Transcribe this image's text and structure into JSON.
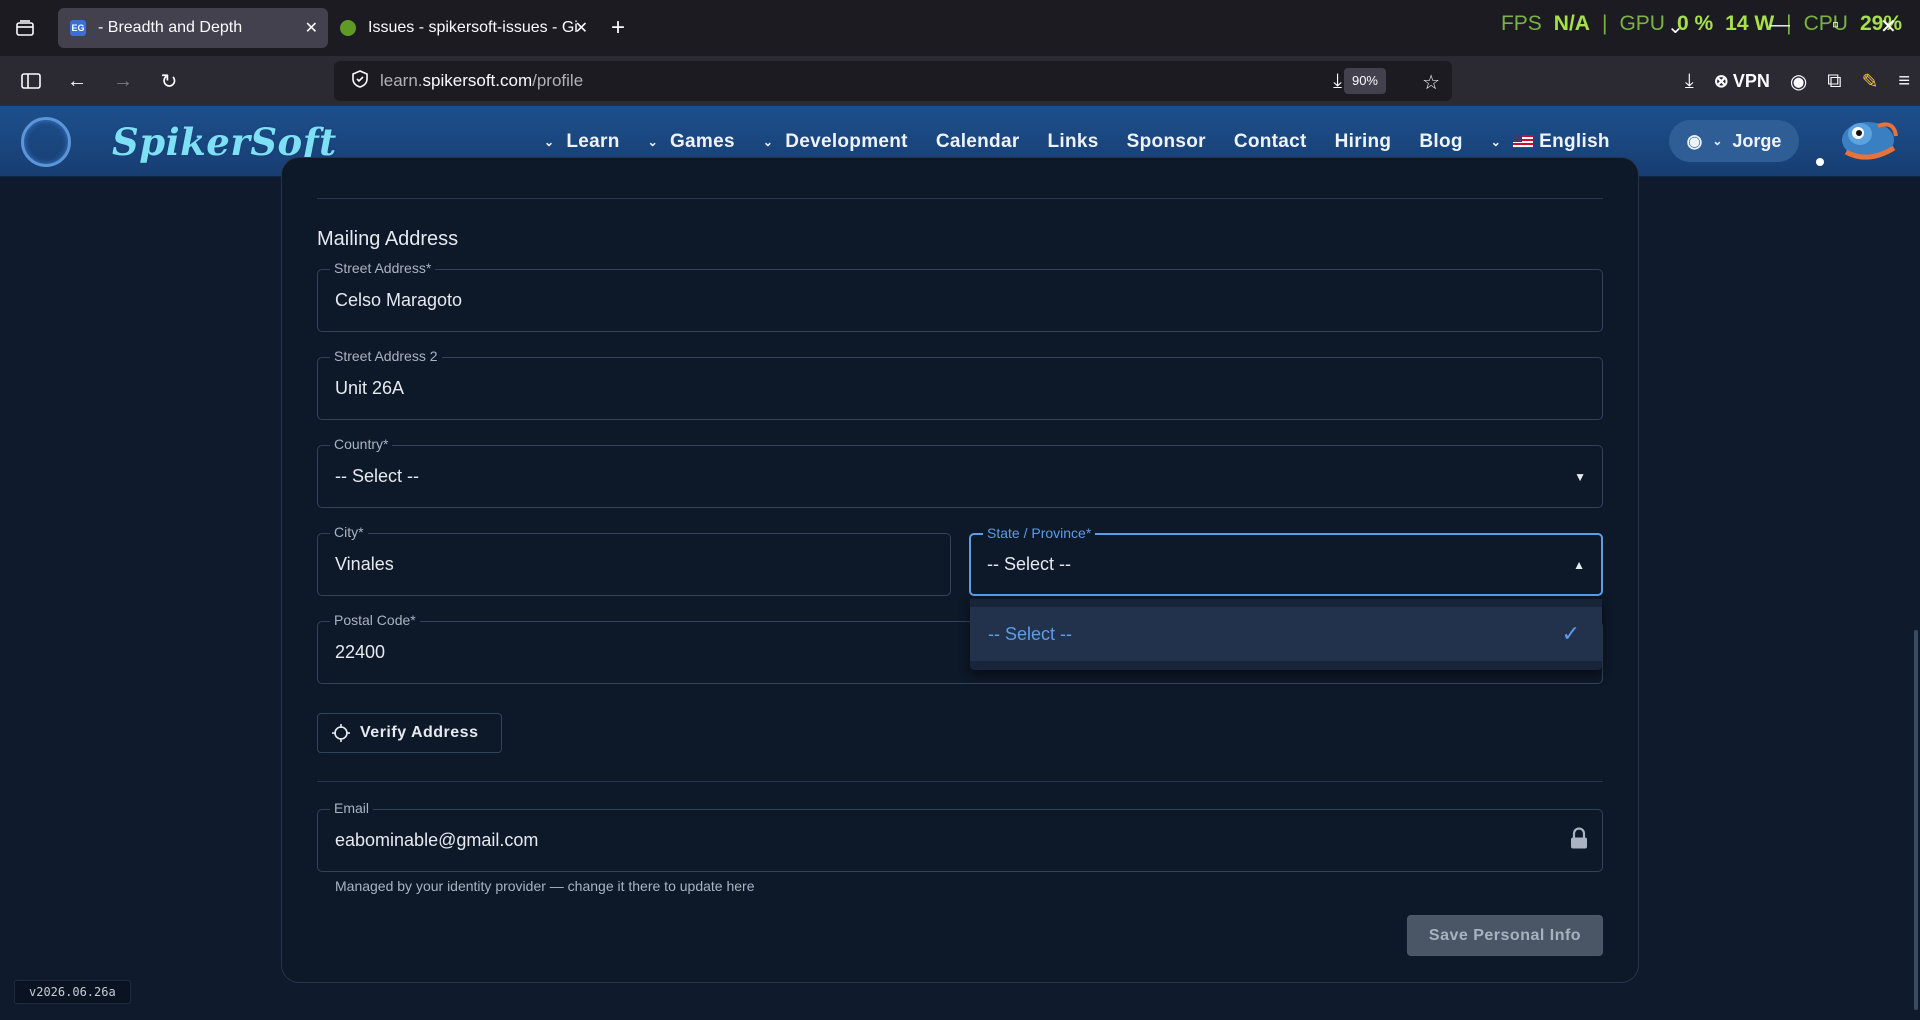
{
  "browser": {
    "tabs": [
      {
        "title": "- Breadth and Depth",
        "favicon_color": "#3b6fd6",
        "favicon_text": "EG",
        "active": true
      },
      {
        "title": "Issues - spikersoft-issues - Gitea",
        "favicon_color": "#609926",
        "active": false
      }
    ],
    "hud": {
      "fps_label": "FPS",
      "fps_value": "N/A",
      "gpu_label": "GPU",
      "gpu_value": "0 %",
      "watt_value": "14 W",
      "cpu_label": "CPU",
      "cpu_value": "29%"
    },
    "url": {
      "prefix": "learn.",
      "host": "spikersoft.com",
      "path": "/profile"
    },
    "zoom": "90%",
    "vpn_label": "VPN"
  },
  "site": {
    "logo_text": "SpikerSoft",
    "menu": [
      {
        "label": "Learn",
        "dropdown": true
      },
      {
        "label": "Games",
        "dropdown": true
      },
      {
        "label": "Development",
        "dropdown": true
      },
      {
        "label": "Calendar",
        "dropdown": false
      },
      {
        "label": "Links",
        "dropdown": false
      },
      {
        "label": "Sponsor",
        "dropdown": false
      },
      {
        "label": "Contact",
        "dropdown": false
      },
      {
        "label": "Hiring",
        "dropdown": false
      },
      {
        "label": "Blog",
        "dropdown": false
      },
      {
        "label": "English",
        "dropdown": true
      }
    ],
    "user_name": "Jorge"
  },
  "form": {
    "section_title": "Mailing Address",
    "street": {
      "label": "Street Address*",
      "value": "Celso Maragoto"
    },
    "street2": {
      "label": "Street Address 2",
      "value": "Unit 26A"
    },
    "country": {
      "label": "Country*",
      "value": "-- Select --"
    },
    "city": {
      "label": "City*",
      "value": "Vinales"
    },
    "state": {
      "label": "State / Province*",
      "value": "-- Select --",
      "options": [
        "-- Select --"
      ],
      "selected": "-- Select --"
    },
    "postal": {
      "label": "Postal Code*",
      "value": "22400"
    },
    "verify_label": "Verify Address",
    "email": {
      "label": "Email",
      "value": "eabominable@gmail.com",
      "help": "Managed by your identity provider — change it there to update here"
    },
    "save_label": "Save Personal Info"
  },
  "version": "v2026.06.26a"
}
